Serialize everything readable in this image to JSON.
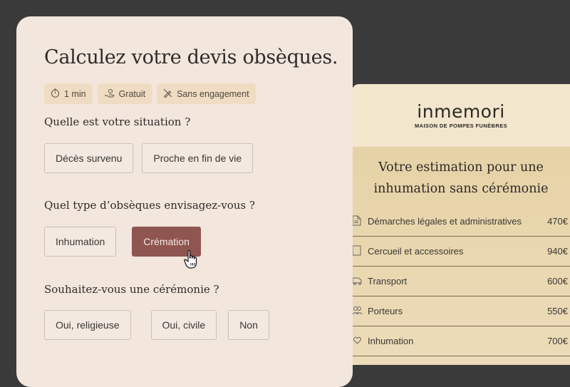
{
  "form": {
    "title": "Calculez votre devis obsèques.",
    "badges": [
      {
        "icon": "stopwatch-icon",
        "label": "1 min"
      },
      {
        "icon": "hand-coin-icon",
        "label": "Gratuit"
      },
      {
        "icon": "no-pen-icon",
        "label": "Sans engagement"
      }
    ],
    "questions": [
      {
        "label": "Quelle est votre situation ?",
        "options": [
          "Décès survenu",
          "Proche en fin de vie"
        ]
      },
      {
        "label": "Quel type d’obsèques envisagez-vous ?",
        "options": [
          "Inhumation",
          "Crémation"
        ],
        "selected": "Crémation"
      },
      {
        "label": "Souhaitez-vous une cérémonie ?",
        "options": [
          "Oui, religieuse",
          "Oui, civile",
          "Non"
        ]
      }
    ]
  },
  "estimate": {
    "brand": "inmemori",
    "tagline": "MAISON DE POMPES FUNÈBRES",
    "title": "Votre estimation pour une inhumation sans cérémonie",
    "lines": [
      {
        "icon": "document-icon",
        "label": "Démarches légales et administratives",
        "amount": "470€"
      },
      {
        "icon": "coffin-icon",
        "label": "Cercueil et accessoires",
        "amount": "940€"
      },
      {
        "icon": "hearse-icon",
        "label": "Transport",
        "amount": "600€"
      },
      {
        "icon": "people-icon",
        "label": "Porteurs",
        "amount": "550€"
      },
      {
        "icon": "heart-hands-icon",
        "label": "Inhumation",
        "amount": "700€"
      }
    ]
  },
  "colors": {
    "background": "#3a3a3a",
    "card": "#f2e6dd",
    "badge": "#f0dcc2",
    "selected": "#8f5551",
    "estimate": "#e7d4aa"
  }
}
